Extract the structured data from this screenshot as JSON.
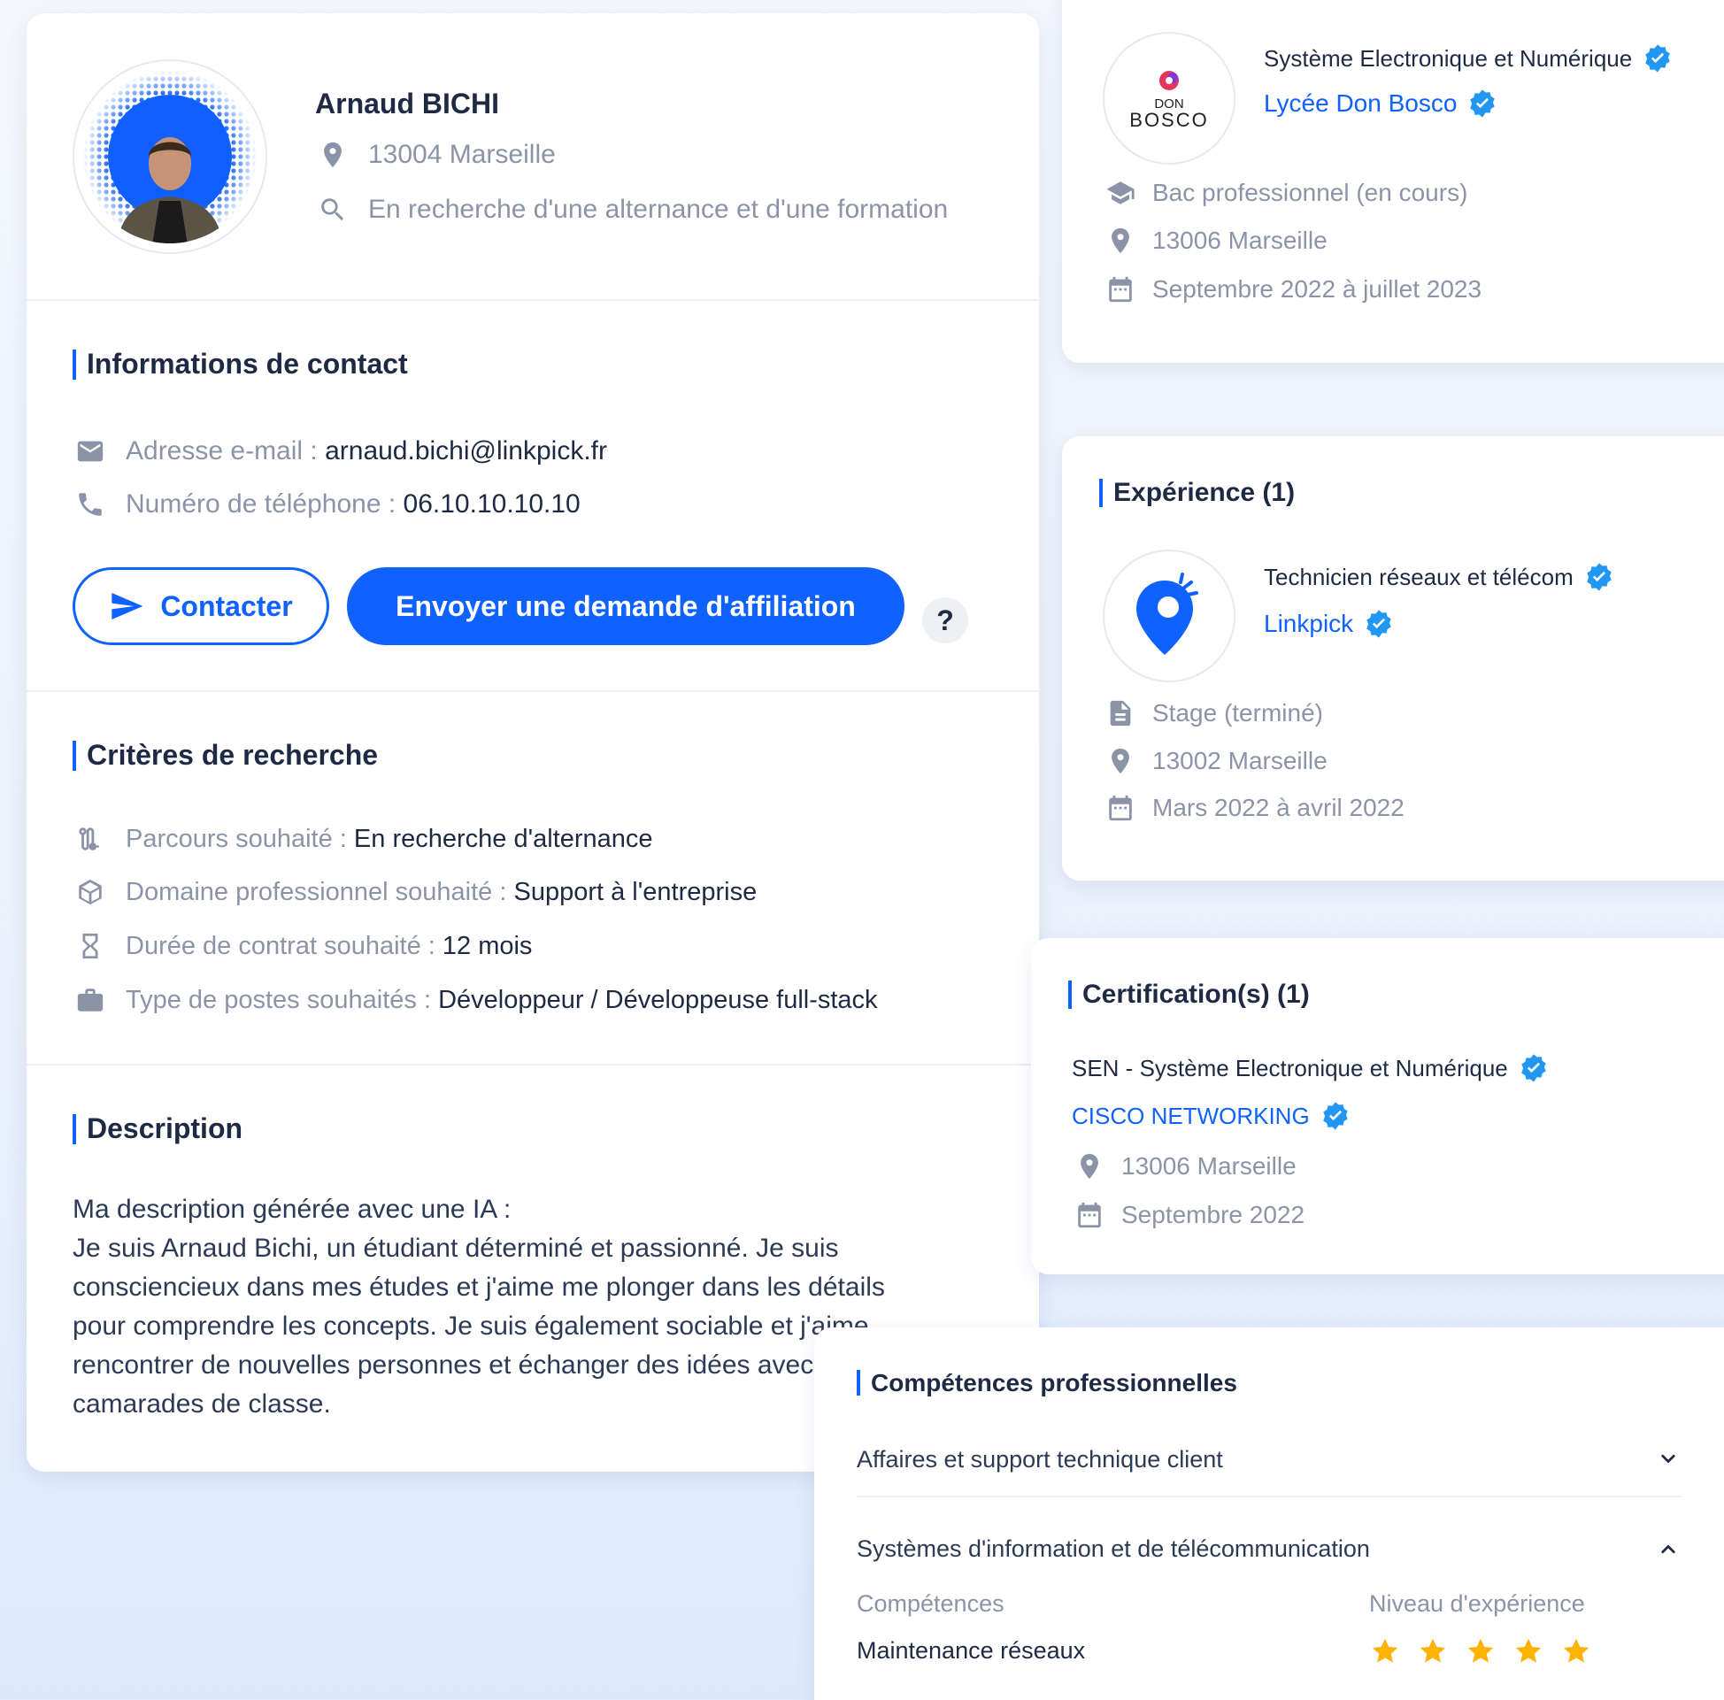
{
  "profile": {
    "name": "Arnaud BICHI",
    "location": "13004 Marseille",
    "status": "En recherche d'une alternance et d'une formation"
  },
  "contact": {
    "title": "Informations de contact",
    "email_label": "Adresse e-mail : ",
    "email_value": "arnaud.bichi@linkpick.fr",
    "phone_label": "Numéro de téléphone : ",
    "phone_value": "06.10.10.10.10",
    "contact_button": "Contacter",
    "affiliation_button": "Envoyer une demande d'affiliation",
    "help_label": "?"
  },
  "criteria": {
    "title": "Critères de recherche",
    "items": [
      {
        "label": "Parcours souhaité : ",
        "value": "En recherche d'alternance",
        "icon": "route-icon"
      },
      {
        "label": "Domaine professionnel souhaité : ",
        "value": "Support à l'entreprise",
        "icon": "cube-icon"
      },
      {
        "label": "Durée de contrat souhaité : ",
        "value": "12 mois",
        "icon": "hourglass-icon"
      },
      {
        "label": "Type de postes souhaités : ",
        "value": "Développeur / Développeuse full-stack",
        "icon": "briefcase-icon"
      }
    ]
  },
  "description": {
    "title": "Description",
    "lines": [
      "Ma description générée avec une IA :",
      "Je suis Arnaud Bichi, un étudiant déterminé et passionné. Je suis",
      "consciencieux dans mes études et j'aime me plonger dans les détails",
      "pour comprendre les concepts. Je suis également sociable et j'aime",
      "rencontrer de nouvelles personnes et échanger des idées avec mes",
      "camarades de classe."
    ]
  },
  "education": {
    "logo_text_top": "DON",
    "logo_text_bottom": "BOSCO",
    "degree": "Système Electronique et Numérique",
    "school": "Lycée Don Bosco",
    "level": "Bac professionnel (en cours)",
    "location": "13006 Marseille",
    "dates": "Septembre 2022 à juillet 2023"
  },
  "experience": {
    "title": "Expérience (1)",
    "job": "Technicien réseaux et télécom",
    "company": "Linkpick",
    "type": "Stage (terminé)",
    "location": "13002 Marseille",
    "dates": "Mars 2022 à avril 2022"
  },
  "certification": {
    "title": "Certification(s) (1)",
    "name": "SEN - Système Electronique et Numérique",
    "issuer": "CISCO NETWORKING",
    "location": "13006 Marseille",
    "date": "Septembre 2022"
  },
  "skills": {
    "title": "Compétences professionnelles",
    "group1": "Affaires et support technique client",
    "group2": "Systèmes d'information et de télécommunication",
    "col_skills": "Compétences",
    "col_level": "Niveau d'expérience",
    "rows": [
      {
        "skill": "Maintenance réseaux",
        "level": 5,
        "max": 5
      }
    ]
  },
  "colors": {
    "accent": "#0f62fe",
    "verified": "#2196f3",
    "star": "#ffb300",
    "muted": "#8b94a7",
    "text": "#1e2a44"
  }
}
